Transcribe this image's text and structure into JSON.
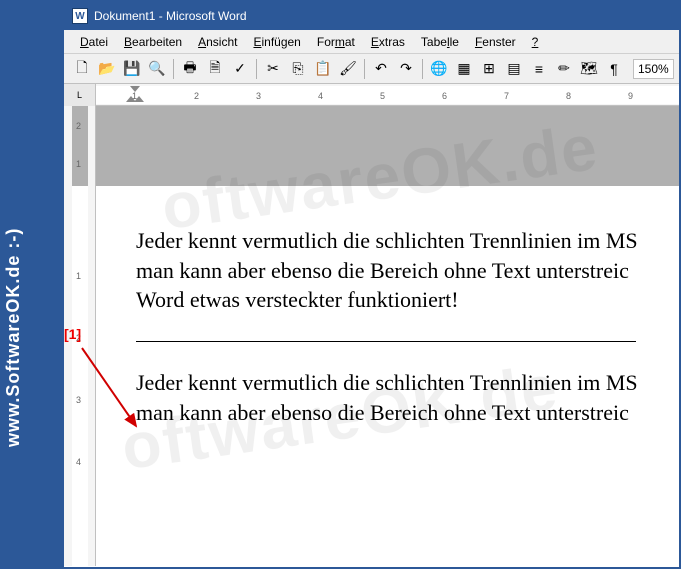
{
  "app": {
    "icon_letter": "W",
    "title": "Dokument1 - Microsoft Word"
  },
  "menu": {
    "items": [
      {
        "label": "Datei",
        "u": 0
      },
      {
        "label": "Bearbeiten",
        "u": 0
      },
      {
        "label": "Ansicht",
        "u": 0
      },
      {
        "label": "Einfügen",
        "u": 0
      },
      {
        "label": "Format",
        "u": 3
      },
      {
        "label": "Extras",
        "u": 0
      },
      {
        "label": "Tabelle",
        "u": 4
      },
      {
        "label": "Fenster",
        "u": 0
      },
      {
        "label": "?",
        "u": 0
      }
    ]
  },
  "toolbar": {
    "buttons": [
      {
        "name": "new-doc-icon",
        "glyph": "🗋"
      },
      {
        "name": "open-icon",
        "glyph": "📂"
      },
      {
        "name": "save-icon",
        "glyph": "💾"
      },
      {
        "name": "search-icon",
        "glyph": "🔍"
      },
      {
        "sep": true
      },
      {
        "name": "print-icon",
        "glyph": "🖶"
      },
      {
        "name": "print-preview-icon",
        "glyph": "🗎"
      },
      {
        "name": "spellcheck-icon",
        "glyph": "✓"
      },
      {
        "sep": true
      },
      {
        "name": "cut-icon",
        "glyph": "✂"
      },
      {
        "name": "copy-icon",
        "glyph": "⎘"
      },
      {
        "name": "paste-icon",
        "glyph": "📋"
      },
      {
        "name": "format-painter-icon",
        "glyph": "🖌"
      },
      {
        "sep": true
      },
      {
        "name": "undo-icon",
        "glyph": "↶"
      },
      {
        "name": "redo-icon",
        "glyph": "↷"
      },
      {
        "sep": true
      },
      {
        "name": "insert-hyperlink-icon",
        "glyph": "🌐"
      },
      {
        "name": "tables-icon",
        "glyph": "▦"
      },
      {
        "name": "insert-table-icon",
        "glyph": "⊞"
      },
      {
        "name": "excel-icon",
        "glyph": "▤"
      },
      {
        "name": "columns-icon",
        "glyph": "≡"
      },
      {
        "name": "drawing-icon",
        "glyph": "✏"
      },
      {
        "name": "doc-map-icon",
        "glyph": "🗺"
      },
      {
        "name": "show-marks-icon",
        "glyph": "¶"
      }
    ],
    "zoom": "150%"
  },
  "ruler": {
    "left_button": "L",
    "numbers": [
      "1",
      "2",
      "3",
      "4",
      "5",
      "6",
      "7",
      "8",
      "9"
    ],
    "v_numbers": [
      "2",
      "1",
      "1",
      "2",
      "3",
      "4"
    ]
  },
  "document": {
    "para1_line1": "Jeder kennt vermutlich die schlichten Trennlinien im MS",
    "para1_line2": "man kann aber ebenso die Bereich ohne Text unterstreic",
    "para1_line3": "Word etwas versteckter funktioniert!",
    "para2_line1": "Jeder kennt vermutlich die schlichten Trennlinien im MS",
    "para2_line2": "man kann aber ebenso die Bereich ohne Text unterstreic"
  },
  "callout": {
    "label": "[1]"
  },
  "sidebar": {
    "text": "www.SoftwareOK.de  :-)"
  },
  "watermark": {
    "text1": "oftwareOK.de",
    "text2": "oftwareOK.de"
  }
}
